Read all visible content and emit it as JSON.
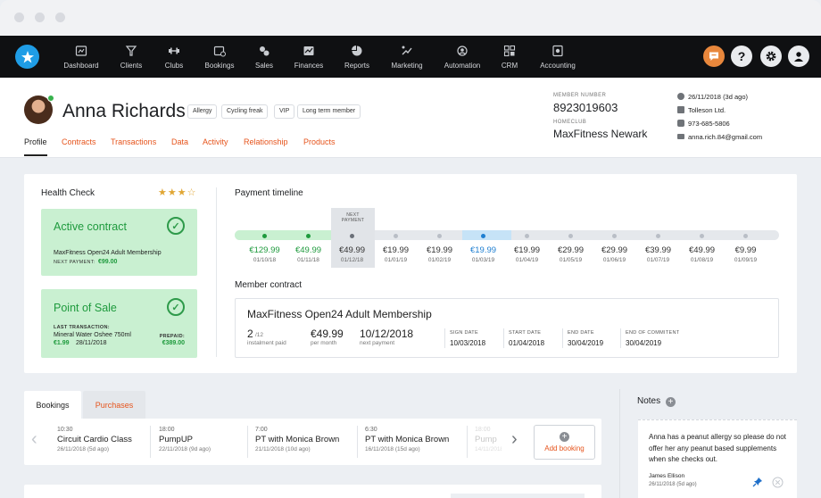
{
  "nav": {
    "items": [
      {
        "label": "Dashboard",
        "icon": "dashboard-icon"
      },
      {
        "label": "Clients",
        "icon": "clients-icon"
      },
      {
        "label": "Clubs",
        "icon": "clubs-icon"
      },
      {
        "label": "Bookings",
        "icon": "bookings-icon"
      },
      {
        "label": "Sales",
        "icon": "sales-icon"
      },
      {
        "label": "Finances",
        "icon": "finances-icon"
      },
      {
        "label": "Reports",
        "icon": "reports-icon"
      },
      {
        "label": "Marketing",
        "icon": "marketing-icon"
      },
      {
        "label": "Automation",
        "icon": "automation-icon"
      },
      {
        "label": "CRM",
        "icon": "crm-icon"
      },
      {
        "label": "Accounting",
        "icon": "accounting-icon"
      }
    ],
    "help_symbol": "?",
    "colors": {
      "bar": "#0f1012",
      "logo": "#1f9de6",
      "chat": "#e8873c"
    }
  },
  "profile": {
    "name": "Anna Richards",
    "tags": [
      "Allergy",
      "Cycling freak",
      "VIP",
      "Long term member"
    ],
    "tabs": [
      "Profile",
      "Contracts",
      "Transactions",
      "Data",
      "Activity",
      "Relationship",
      "Products"
    ],
    "member_number_label": "MEMBER NUMBER",
    "member_number": "8923019603",
    "homeclub_label": "HOMECLUB",
    "homeclub": "MaxFitness Newark",
    "contact": {
      "last_visit": "26/11/2018 (3d ago)",
      "company": "Tolleson Ltd.",
      "phone": "973-685-5806",
      "email": "anna.rich.84@gmail.com"
    }
  },
  "health": {
    "title": "Health Check",
    "rating": "★★★☆",
    "active_contract": {
      "title": "Active contract",
      "name": "MaxFitness Open24 Adult Membership",
      "next_payment_label": "NEXT PAYMENT:",
      "next_payment": "€99.00"
    },
    "point_of_sale": {
      "title": "Point of Sale",
      "last_label": "LAST TRANSACTION:",
      "item": "Mineral Water Oshee 750ml",
      "amount": "€1.99",
      "date": "28/11/2018",
      "prepaid_label": "PREPAID:",
      "prepaid": "€389.00"
    }
  },
  "timeline": {
    "title": "Payment timeline",
    "next_label_1": "NEXT",
    "next_label_2": "PAYMENT",
    "payments": [
      {
        "amount": "€129.99",
        "date": "01/10/18",
        "status": "paid"
      },
      {
        "amount": "€49.99",
        "date": "01/11/18",
        "status": "paid"
      },
      {
        "amount": "€49.99",
        "date": "01/12/18",
        "status": "next"
      },
      {
        "amount": "€19.99",
        "date": "01/01/19",
        "status": "future"
      },
      {
        "amount": "€19.99",
        "date": "01/02/19",
        "status": "future"
      },
      {
        "amount": "€19.99",
        "date": "01/03/19",
        "status": "highlight"
      },
      {
        "amount": "€19.99",
        "date": "01/04/19",
        "status": "future"
      },
      {
        "amount": "€29.99",
        "date": "01/05/19",
        "status": "future"
      },
      {
        "amount": "€29.99",
        "date": "01/06/19",
        "status": "future"
      },
      {
        "amount": "€39.99",
        "date": "01/07/19",
        "status": "future"
      },
      {
        "amount": "€49.99",
        "date": "01/08/19",
        "status": "future"
      },
      {
        "amount": "€9.99",
        "date": "01/09/19",
        "status": "future"
      }
    ]
  },
  "contract": {
    "title": "Member contract",
    "name": "MaxFitness Open24 Adult Membership",
    "paid": "2",
    "paid_of": "/12",
    "paid_label": "instalment paid",
    "price": "€49.99",
    "price_label": "per month",
    "next": "10/12/2018",
    "next_label": "next payment",
    "sign_label": "SIGN DATE",
    "sign": "10/03/2018",
    "start_label": "START DATE",
    "start": "01/04/2018",
    "end_label": "END DATE",
    "end": "30/04/2019",
    "commit_label": "END OF COMMITENT",
    "commit": "30/04/2019"
  },
  "bookings": {
    "tabs": [
      "Bookings",
      "Purchases"
    ],
    "items": [
      {
        "time": "10:30",
        "name": "Circuit Cardio Class",
        "date": "26/11/2018 (5d ago)"
      },
      {
        "time": "18:00",
        "name": "PumpUP",
        "date": "22/11/2018 (9d ago)"
      },
      {
        "time": "7:00",
        "name": "PT with Monica Brown",
        "date": "21/11/2018 (10d ago)"
      },
      {
        "time": "6:30",
        "name": "PT with Monica Brown",
        "date": "16/11/2018 (15d ago)"
      },
      {
        "time": "18:00",
        "name": "Pump",
        "date": "14/11/2018"
      }
    ],
    "prev": "‹",
    "next": "›",
    "add_label": "Add booking"
  },
  "notes": {
    "title": "Notes",
    "text": "Anna has a peanut allergy so please do not offer her any peanut based supplements when she checks out.",
    "author": "James Ellison",
    "date": "26/11/2018 (5d ago)"
  }
}
